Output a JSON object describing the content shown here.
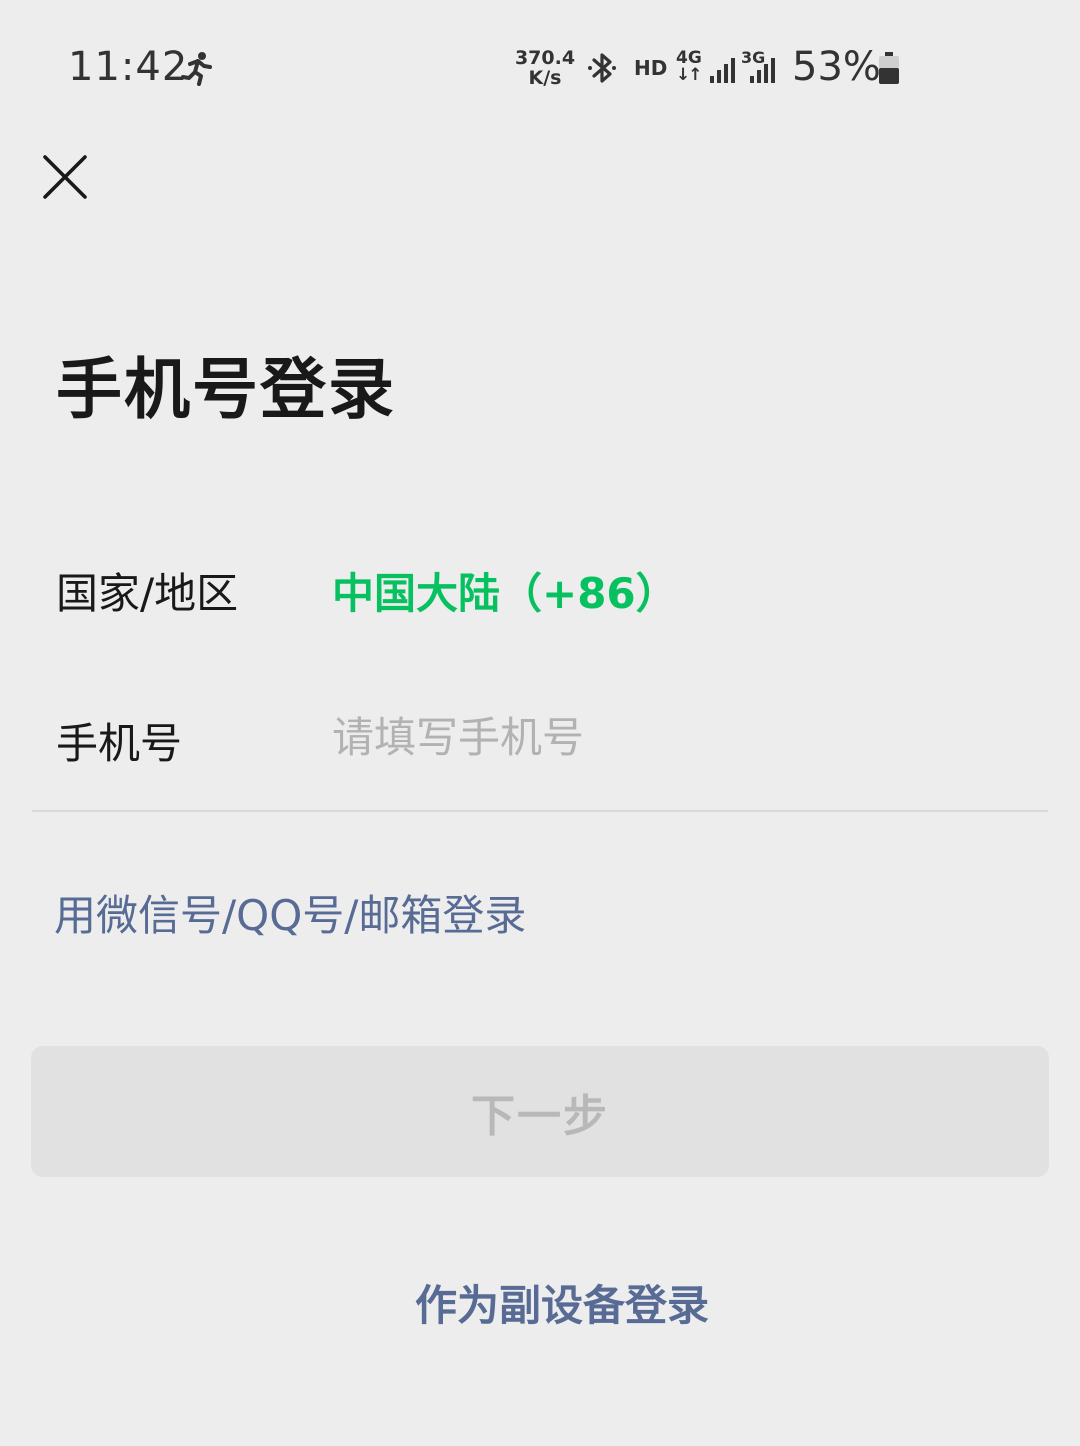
{
  "status_bar": {
    "time": "11:42",
    "net_speed_value": "370.4",
    "net_speed_unit": "K/s",
    "hd_label": "HD",
    "network_4g": "4G",
    "network_3g": "3G",
    "battery_percent": "53%",
    "icons": [
      "running-icon",
      "bluetooth-icon",
      "signal-icon",
      "battery-icon"
    ]
  },
  "header": {
    "close_icon": "close-icon"
  },
  "page": {
    "title": "手机号登录"
  },
  "form": {
    "region_label": "国家/地区",
    "region_value": "中国大陆（+86）",
    "phone_label": "手机号",
    "phone_placeholder": "请填写手机号",
    "phone_value": ""
  },
  "links": {
    "alt_login": "用微信号/QQ号/邮箱登录",
    "secondary_device": "作为副设备登录"
  },
  "buttons": {
    "next_label": "下一步",
    "next_enabled": false
  },
  "colors": {
    "background": "#ededed",
    "accent_green": "#07c160",
    "link_blue": "#576b95",
    "button_disabled_bg": "#e1e1e1",
    "button_disabled_text": "#b8b8b8",
    "placeholder": "#b2b2b2"
  }
}
